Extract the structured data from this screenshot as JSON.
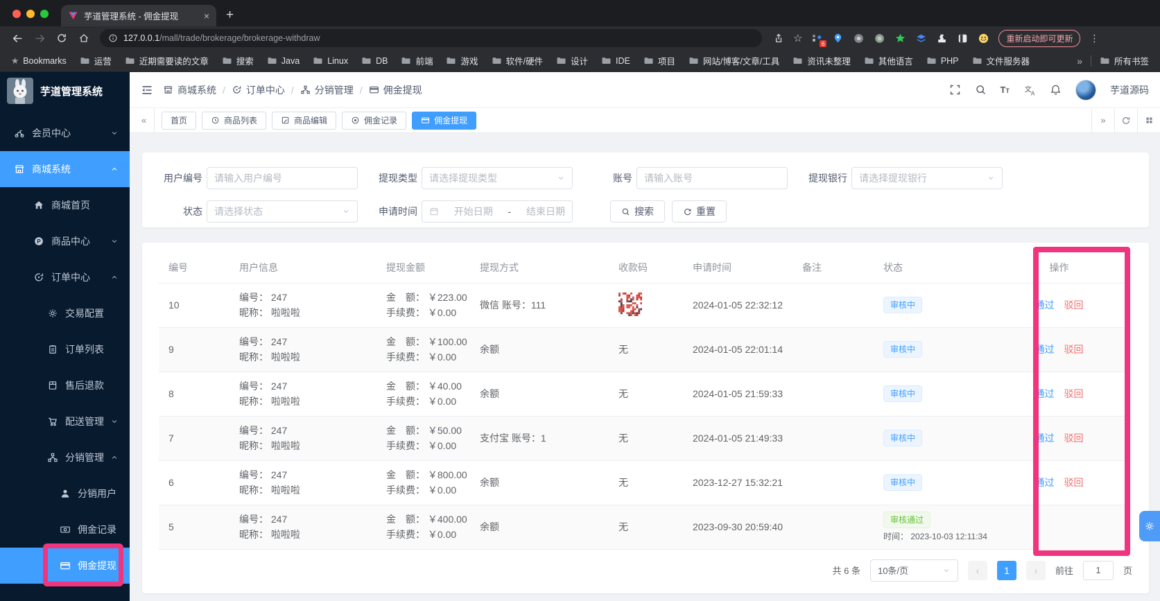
{
  "colors": {
    "accent": "#409eff",
    "annotation_pink": "#f0357f",
    "status_pending": "#409eff",
    "status_success": "#67c23a",
    "reject_red": "#f56c6c"
  },
  "browser": {
    "tab": {
      "title": "芋道管理系统 - 佣金提现"
    },
    "url_host": "127.0.0.1",
    "url_path": "/mall/trade/brokerage/brokerage-withdraw",
    "update_button": "重新启动即可更新",
    "extension_badge": "6",
    "extensions": [
      "extension-grid-diamond",
      "extension-pin-blue",
      "extension-circle-gray",
      "extension-circle-sage",
      "extension-star-green",
      "extension-layers-blue",
      "extension-puzzle",
      "extension-contrast",
      "extension-emoji"
    ],
    "bookmarks_bar": {
      "root_label": "Bookmarks",
      "folders": [
        "运营",
        "近期需要读的文章",
        "搜索",
        "Java",
        "Linux",
        "DB",
        "前端",
        "游戏",
        "软件/硬件",
        "设计",
        "IDE",
        "项目",
        "网站/博客/文章/工具",
        "资讯未整理",
        "其他语言",
        "PHP",
        "文件服务器"
      ],
      "overflow": "»",
      "all_bookmarks": "所有书签"
    }
  },
  "app": {
    "logo_title": "芋道管理系统",
    "header": {
      "breadcrumb": [
        {
          "icon": "shop",
          "label": "商城系统"
        },
        {
          "icon": "order",
          "label": "订单中心"
        },
        {
          "icon": "share",
          "label": "分销管理"
        },
        {
          "icon": "card",
          "label": "佣金提现"
        }
      ],
      "user_name": "芋道源码"
    },
    "page_tabs": [
      {
        "label": "首页",
        "icon": "",
        "active": false
      },
      {
        "label": "商品列表",
        "icon": "refresh-circle",
        "active": false
      },
      {
        "label": "商品编辑",
        "icon": "edit",
        "active": false
      },
      {
        "label": "佣金记录",
        "icon": "record",
        "active": false
      },
      {
        "label": "佣金提现",
        "icon": "card",
        "active": true
      }
    ]
  },
  "sidebar": {
    "items": [
      {
        "label": "会员中心",
        "icon": "member",
        "level": 1,
        "chevron": "down",
        "active": false
      },
      {
        "label": "商城系统",
        "icon": "shop",
        "level": 1,
        "chevron": "up",
        "active": true
      },
      {
        "label": "商城首页",
        "icon": "home",
        "level": 2,
        "chevron": "",
        "active": false
      },
      {
        "label": "商品中心",
        "icon": "product",
        "level": 2,
        "chevron": "down",
        "active": false
      },
      {
        "label": "订单中心",
        "icon": "order",
        "level": 2,
        "chevron": "up",
        "active": false
      },
      {
        "label": "交易配置",
        "icon": "gear",
        "level": 3,
        "chevron": "",
        "active": false
      },
      {
        "label": "订单列表",
        "icon": "list",
        "level": 3,
        "chevron": "",
        "active": false
      },
      {
        "label": "售后退款",
        "icon": "refund",
        "level": 3,
        "chevron": "",
        "active": false
      },
      {
        "label": "配送管理",
        "icon": "delivery",
        "level": 3,
        "chevron": "down",
        "active": false
      },
      {
        "label": "分销管理",
        "icon": "share",
        "level": 3,
        "chevron": "up",
        "active": false
      },
      {
        "label": "分销用户",
        "icon": "user",
        "level": 4,
        "chevron": "",
        "active": false
      },
      {
        "label": "佣金记录",
        "icon": "bill",
        "level": 4,
        "chevron": "",
        "active": false
      },
      {
        "label": "佣金提现",
        "icon": "card",
        "level": 4,
        "chevron": "",
        "active": true
      }
    ]
  },
  "filters": {
    "user_no": {
      "label": "用户编号",
      "placeholder": "请输入用户编号"
    },
    "withdraw_type": {
      "label": "提现类型",
      "placeholder": "请选择提现类型"
    },
    "account": {
      "label": "账号",
      "placeholder": "请输入账号"
    },
    "bank": {
      "label": "提现银行",
      "placeholder": "请选择提现银行"
    },
    "status": {
      "label": "状态",
      "placeholder": "请选择状态"
    },
    "apply_time": {
      "label": "申请时间",
      "start": "开始日期",
      "separator": "-",
      "end": "结束日期"
    },
    "search_label": "搜索",
    "reset_label": "重置"
  },
  "table": {
    "columns": [
      "编号",
      "用户信息",
      "提现金额",
      "提现方式",
      "收款码",
      "申请时间",
      "备注",
      "状态",
      "操作"
    ],
    "user_id_label": "编号：",
    "nickname_label": "昵称：",
    "amount_label": "金　额：",
    "fee_label": "手续费：",
    "approve_label": "通过",
    "reject_label": "驳回",
    "rows": [
      {
        "id": "10",
        "user_id": "247",
        "nickname": "啦啦啦",
        "amount": "￥223.00",
        "fee": "￥0.00",
        "method": "微信 账号：111",
        "code": "qr",
        "time": "2024-01-05 22:32:12",
        "remark": "",
        "status": "审核中",
        "status_type": "pending",
        "status_time": "",
        "has_actions": true
      },
      {
        "id": "9",
        "user_id": "247",
        "nickname": "啦啦啦",
        "amount": "￥100.00",
        "fee": "￥0.00",
        "method": "余额",
        "code": "无",
        "time": "2024-01-05 22:01:14",
        "remark": "",
        "status": "审核中",
        "status_type": "pending",
        "status_time": "",
        "has_actions": true
      },
      {
        "id": "8",
        "user_id": "247",
        "nickname": "啦啦啦",
        "amount": "￥40.00",
        "fee": "￥0.00",
        "method": "余额",
        "code": "无",
        "time": "2024-01-05 21:59:33",
        "remark": "",
        "status": "审核中",
        "status_type": "pending",
        "status_time": "",
        "has_actions": true
      },
      {
        "id": "7",
        "user_id": "247",
        "nickname": "啦啦啦",
        "amount": "￥50.00",
        "fee": "￥0.00",
        "method": "支付宝 账号：1",
        "code": "无",
        "time": "2024-01-05 21:49:33",
        "remark": "",
        "status": "审核中",
        "status_type": "pending",
        "status_time": "",
        "has_actions": true
      },
      {
        "id": "6",
        "user_id": "247",
        "nickname": "啦啦啦",
        "amount": "￥800.00",
        "fee": "￥0.00",
        "method": "余额",
        "code": "无",
        "time": "2023-12-27 15:32:21",
        "remark": "",
        "status": "审核中",
        "status_type": "pending",
        "status_time": "",
        "has_actions": true
      },
      {
        "id": "5",
        "user_id": "247",
        "nickname": "啦啦啦",
        "amount": "￥400.00",
        "fee": "￥0.00",
        "method": "余额",
        "code": "无",
        "time": "2023-09-30 20:59:40",
        "remark": "",
        "status": "审核通过",
        "status_type": "success",
        "status_time": "时间： 2023-10-03 12:11:34",
        "has_actions": false
      }
    ]
  },
  "pagination": {
    "total": "共 6 条",
    "page_size": "10条/页",
    "prev": "‹",
    "current": "1",
    "next": "›",
    "goto_label": "前往",
    "goto_value": "1",
    "page_label": "页"
  }
}
